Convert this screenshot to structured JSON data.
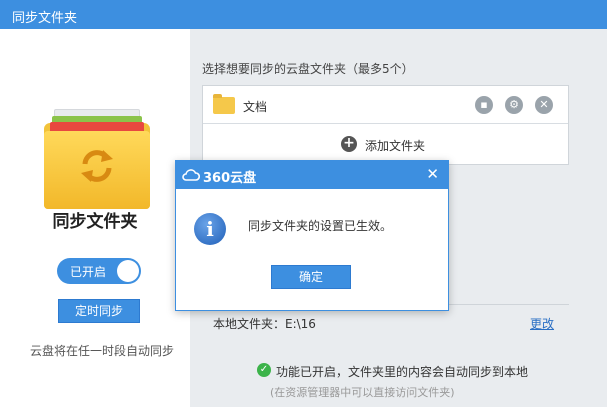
{
  "window": {
    "title": "同步文件夹"
  },
  "left_panel": {
    "heading": "同步文件夹",
    "toggle_label": "已开启",
    "timed_sync_label": "定时同步",
    "note": "云盘将在任一时段自动同步"
  },
  "right_panel": {
    "choose_label": "选择想要同步的云盘文件夹（最多5个）",
    "folders": [
      {
        "name": "文档"
      }
    ],
    "add_label": "添加文件夹",
    "local_label": "本地文件夹：E:\\16",
    "change_label": "更改",
    "status_text": "功能已开启，文件夹里的内容会自动同步到本地",
    "status_sub": "(在资源管理器中可以直接访问文件夹)"
  },
  "dialog": {
    "title": "360云盘",
    "message": "同步文件夹的设置已生效。",
    "ok_label": "确定"
  },
  "icons": {
    "minimize": "minimize-icon",
    "close": "close-icon",
    "sync": "sync-icon",
    "folder": "folder-icon",
    "open_folder": "open-folder-icon",
    "settings": "gear-icon",
    "remove": "remove-icon",
    "add": "plus-icon",
    "check": "check-icon",
    "info": "info-icon",
    "cloud": "cloud-icon"
  },
  "colors": {
    "accent": "#3d8fe0",
    "folder_yellow": "#f2c33a",
    "link": "#2a6fc4",
    "success": "#3cb34a"
  }
}
